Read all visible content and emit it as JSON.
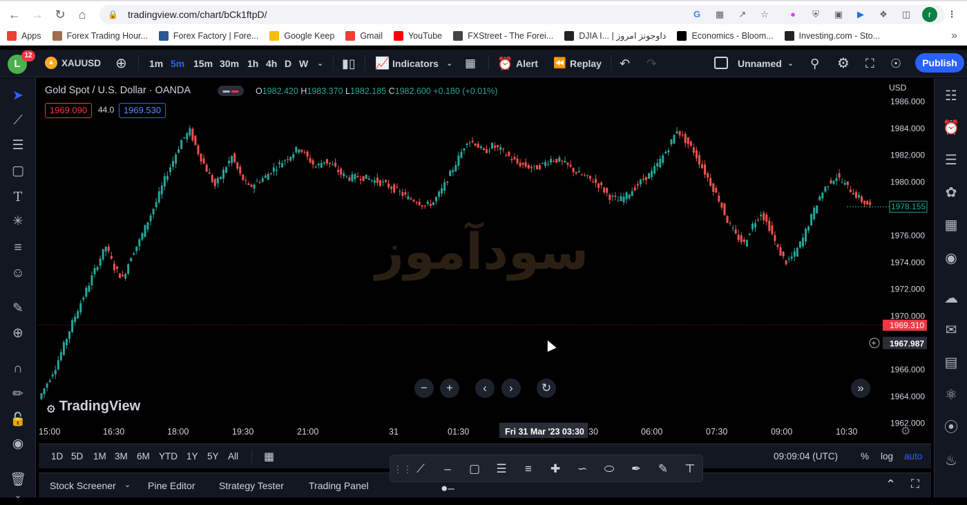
{
  "browser": {
    "url": "tradingview.com/chart/bCk1ftpD/",
    "profile_initial": "r",
    "bookmarks": [
      {
        "label": "Apps",
        "color": "#ea4335",
        "icon": "apps-grid-icon"
      },
      {
        "label": "Forex Trading Hour...",
        "color": "#a07050",
        "icon": "clock-icon"
      },
      {
        "label": "Forex Factory | Fore...",
        "color": "#2b5797",
        "icon": "forexfactory-icon"
      },
      {
        "label": "Google Keep",
        "color": "#fbbc04",
        "icon": "keep-icon"
      },
      {
        "label": "Gmail",
        "color": "#ea4335",
        "icon": "gmail-icon"
      },
      {
        "label": "YouTube",
        "color": "#ff0000",
        "icon": "youtube-icon"
      },
      {
        "label": "FXStreet - The Forei...",
        "color": "#444444",
        "icon": "fxstreet-icon"
      },
      {
        "label": "DJIA I... | داوجونز امروز",
        "color": "#222222",
        "icon": "investing-icon"
      },
      {
        "label": "Economics - Bloom...",
        "color": "#000000",
        "icon": "bloomberg-icon"
      },
      {
        "label": "Investing.com - Sto...",
        "color": "#222222",
        "icon": "investing-icon"
      }
    ],
    "more": "»"
  },
  "toolbar": {
    "avatar_initial": "L",
    "notification_count": "12",
    "symbol": "XAUUSD",
    "intervals": [
      "1m",
      "5m",
      "15m",
      "30m",
      "1h",
      "4h",
      "D",
      "W"
    ],
    "active_interval": "5m",
    "indicators_label": "Indicators",
    "alert_label": "Alert",
    "replay_label": "Replay",
    "layout_name": "Unnamed",
    "publish_label": "Publish"
  },
  "legend": {
    "title": "Gold Spot / U.S. Dollar · OANDA",
    "open_label": "O",
    "open": "1982.420",
    "high_label": "H",
    "high": "1983.370",
    "low_label": "L",
    "low": "1982.185",
    "close_label": "C",
    "close": "1982.600",
    "change": "+0.180 (+0.01%)",
    "bid": "1969.090",
    "spread": "44.0",
    "ask": "1969.530"
  },
  "watermark": {
    "brand": "TradingView",
    "overlay_text": "سودآموز"
  },
  "chart_data": {
    "type": "candlestick",
    "currency": "USD",
    "y_ticks": [
      "1986.000",
      "1984.000",
      "1982.000",
      "1980.000",
      "1978.000",
      "1976.000",
      "1974.000",
      "1972.000",
      "1970.000",
      "1968.000",
      "1966.000",
      "1964.000",
      "1962.000"
    ],
    "ylim": [
      1962,
      1986.5
    ],
    "x_ticks": [
      "15:00",
      "16:30",
      "18:00",
      "19:30",
      "21:00",
      "31",
      "01:30",
      "Fri 31 Mar '23 03:30",
      "06:00",
      "07:30",
      "09:00",
      "10:30"
    ],
    "price_labels": [
      {
        "value": "1978.155",
        "color": "#26a69a"
      },
      {
        "value": "1969.310",
        "color": "#f23645"
      },
      {
        "value": "1967.987",
        "color": "#d1d4dc"
      }
    ],
    "bid_line": 1969.31,
    "close_series": [
      1965.0,
      1966.2,
      1967.8,
      1969.5,
      1971.0,
      1972.4,
      1973.9,
      1975.2,
      1973.6,
      1972.8,
      1974.5,
      1975.6,
      1977.1,
      1978.5,
      1980.2,
      1981.6,
      1983.1,
      1983.8,
      1982.2,
      1980.9,
      1979.7,
      1980.8,
      1981.9,
      1980.5,
      1979.6,
      1980.0,
      1980.4,
      1981.0,
      1981.5,
      1982.0,
      1982.6,
      1981.8,
      1981.1,
      1981.6,
      1981.2,
      1980.6,
      1980.3,
      1980.4,
      1980.3,
      1980.1,
      1979.9,
      1979.6,
      1979.2,
      1978.8,
      1978.6,
      1978.2,
      1978.5,
      1979.4,
      1980.6,
      1981.8,
      1983.1,
      1982.9,
      1982.2,
      1982.7,
      1982.4,
      1981.9,
      1981.4,
      1981.2,
      1981.0,
      1981.3,
      1981.7,
      1981.6,
      1981.2,
      1980.7,
      1980.4,
      1980.1,
      1979.6,
      1978.9,
      1978.6,
      1979.0,
      1979.6,
      1980.2,
      1980.7,
      1981.6,
      1982.6,
      1983.9,
      1983.1,
      1982.3,
      1981.1,
      1979.9,
      1978.7,
      1977.1,
      1976.0,
      1975.4,
      1976.8,
      1977.7,
      1976.6,
      1975.0,
      1974.0,
      1974.6,
      1975.8,
      1977.4,
      1978.9,
      1979.9,
      1980.4,
      1979.8,
      1979.2,
      1978.6,
      1978.2
    ]
  },
  "time_range": {
    "ranges": [
      "1D",
      "5D",
      "1M",
      "3M",
      "6M",
      "YTD",
      "1Y",
      "5Y",
      "All"
    ],
    "clock": "09:09:04 (UTC)",
    "percent": "%",
    "log": "log",
    "auto": "auto"
  },
  "bottom_tabs": [
    "Stock Screener",
    "Pine Editor",
    "Strategy Tester",
    "Trading Panel"
  ],
  "colors": {
    "up": "#26a69a",
    "down": "#ef5350",
    "accent": "#2962ff",
    "background": "#000000",
    "panel": "#131722"
  }
}
